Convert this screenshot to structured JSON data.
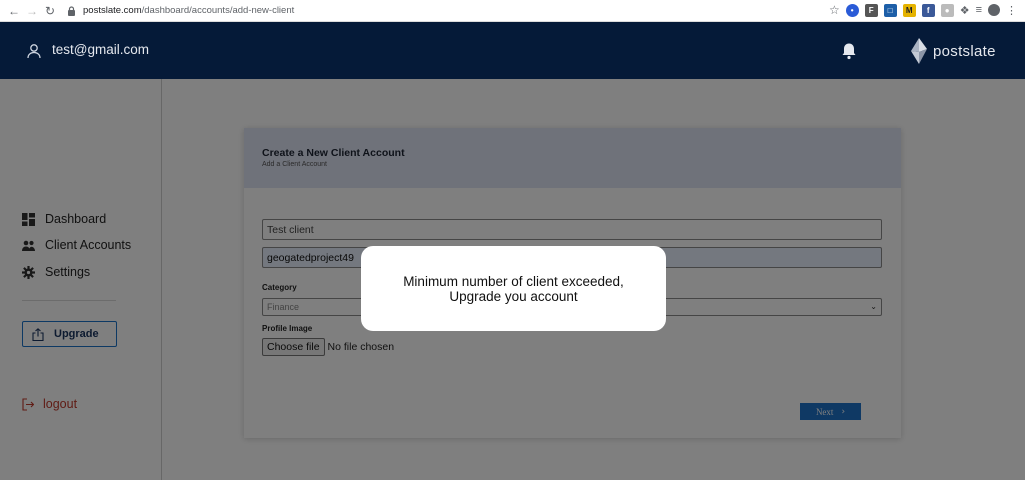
{
  "browser": {
    "url_host": "postslate.com",
    "url_path": "/dashboard/accounts/add-new-client"
  },
  "header": {
    "email": "test@gmail.com",
    "logo_text": "postslate"
  },
  "sidebar": {
    "items": [
      {
        "label": "Dashboard",
        "icon": "grid-icon"
      },
      {
        "label": "Client Accounts",
        "icon": "users-icon"
      },
      {
        "label": "Settings",
        "icon": "gear-icon"
      }
    ],
    "upgrade_label": "Upgrade",
    "logout_label": "logout"
  },
  "form": {
    "title": "Create a New Client Account",
    "subtitle": "Add a Client Account",
    "client_name_placeholder": "Test client",
    "username_value": "geogatedproject49",
    "category_label": "Category",
    "category_value": "Finance",
    "profile_image_label": "Profile Image",
    "choose_file_label": "Choose file",
    "no_file_text": "No file chosen",
    "next_label": "Next"
  },
  "modal": {
    "line1": "Minimum number of client exceeded,",
    "line2": "Upgrade you account"
  },
  "colors": {
    "header_bg": "#051a38",
    "accent": "#1f73c8",
    "logout": "#c0392b"
  }
}
